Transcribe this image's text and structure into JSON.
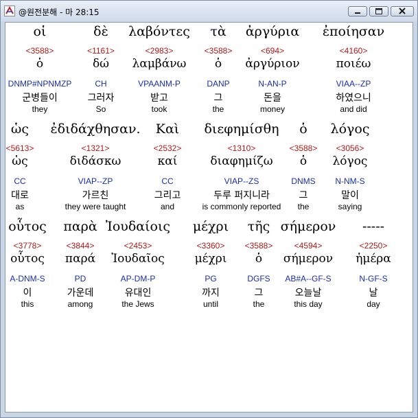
{
  "window": {
    "title": "@원전분해 - 마 28:15"
  },
  "rows": [
    [
      {
        "greek": "οἱ",
        "strong": "<3588>",
        "lemma": "ὁ",
        "morph": "DNMP#NPNMZP",
        "korean": "군병들이",
        "english": "they"
      },
      {
        "greek": "δὲ",
        "strong": "<1161>",
        "lemma": "δώ",
        "morph": "CH",
        "korean": "그러자",
        "english": "So"
      },
      {
        "greek": "λαβόντες",
        "strong": "<2983>",
        "lemma": "λαμβάνω",
        "morph": "VPAANM-P",
        "korean": "받고",
        "english": "took"
      },
      {
        "greek": "τὰ",
        "strong": "<3588>",
        "lemma": "ὁ",
        "morph": "DANP",
        "korean": "그",
        "english": "the"
      },
      {
        "greek": "ἀργύρια",
        "strong": "<694>",
        "lemma": "ἀργύριον",
        "morph": "N-AN-P",
        "korean": "돈을",
        "english": "money"
      },
      {
        "greek": "ἐποίησαν",
        "strong": "<4160>",
        "lemma": "ποιέω",
        "morph": "VIAA--ZP",
        "korean": "하였으니",
        "english": "and did"
      }
    ],
    [
      {
        "greek": "ὡς",
        "strong": "<5613>",
        "lemma": "ὡς",
        "morph": "CC",
        "korean": "대로",
        "english": "as"
      },
      {
        "greek": "ἐδιδάχθησαν.",
        "strong": "<1321>",
        "lemma": "διδάσκω",
        "morph": "VIAP--ZP",
        "korean": "가르친",
        "english": "they were taught"
      },
      {
        "greek": "Καὶ",
        "strong": "<2532>",
        "lemma": "καί",
        "morph": "CC",
        "korean": "그리고",
        "english": "and"
      },
      {
        "greek": "διεφημίσθη",
        "strong": "<1310>",
        "lemma": "διαφημίζω",
        "morph": "VIAP--ZS",
        "korean": "두루 퍼지니라",
        "english": "is commonly reported"
      },
      {
        "greek": "ὁ",
        "strong": "<3588>",
        "lemma": "ὁ",
        "morph": "DNMS",
        "korean": "그",
        "english": "the"
      },
      {
        "greek": "λόγος",
        "strong": "<3056>",
        "lemma": "λόγος",
        "morph": "N-NM-S",
        "korean": "말이",
        "english": "saying"
      }
    ],
    [
      {
        "greek": "οὗτος",
        "strong": "<3778>",
        "lemma": "οὗτος",
        "morph": "A-DNM-S",
        "korean": "이",
        "english": "this"
      },
      {
        "greek": "παρὰ",
        "strong": "<3844>",
        "lemma": "παρά",
        "morph": "PD",
        "korean": "가운데",
        "english": "among"
      },
      {
        "greek": "Ἰουδαίοις",
        "strong": "<2453>",
        "lemma": "Ἰουδαῖος",
        "morph": "AP-DM-P",
        "korean": "유대인",
        "english": "the Jews"
      },
      {
        "greek": "μέχρι",
        "strong": "<3360>",
        "lemma": "μέχρι",
        "morph": "PG",
        "korean": "까지",
        "english": "until"
      },
      {
        "greek": "τῆς",
        "strong": "<3588>",
        "lemma": "ὁ",
        "morph": "DGFS",
        "korean": "그",
        "english": "the"
      },
      {
        "greek": "σήμερον",
        "strong": "<4594>",
        "lemma": "σήμερον",
        "morph": "AB#A--GF-S",
        "korean": "오늘날",
        "english": "this day"
      },
      {
        "greek": "-----",
        "strong": "<2250>",
        "lemma": "ἡμέρα",
        "morph": "N-GF-S",
        "korean": "날",
        "english": "day"
      }
    ]
  ]
}
